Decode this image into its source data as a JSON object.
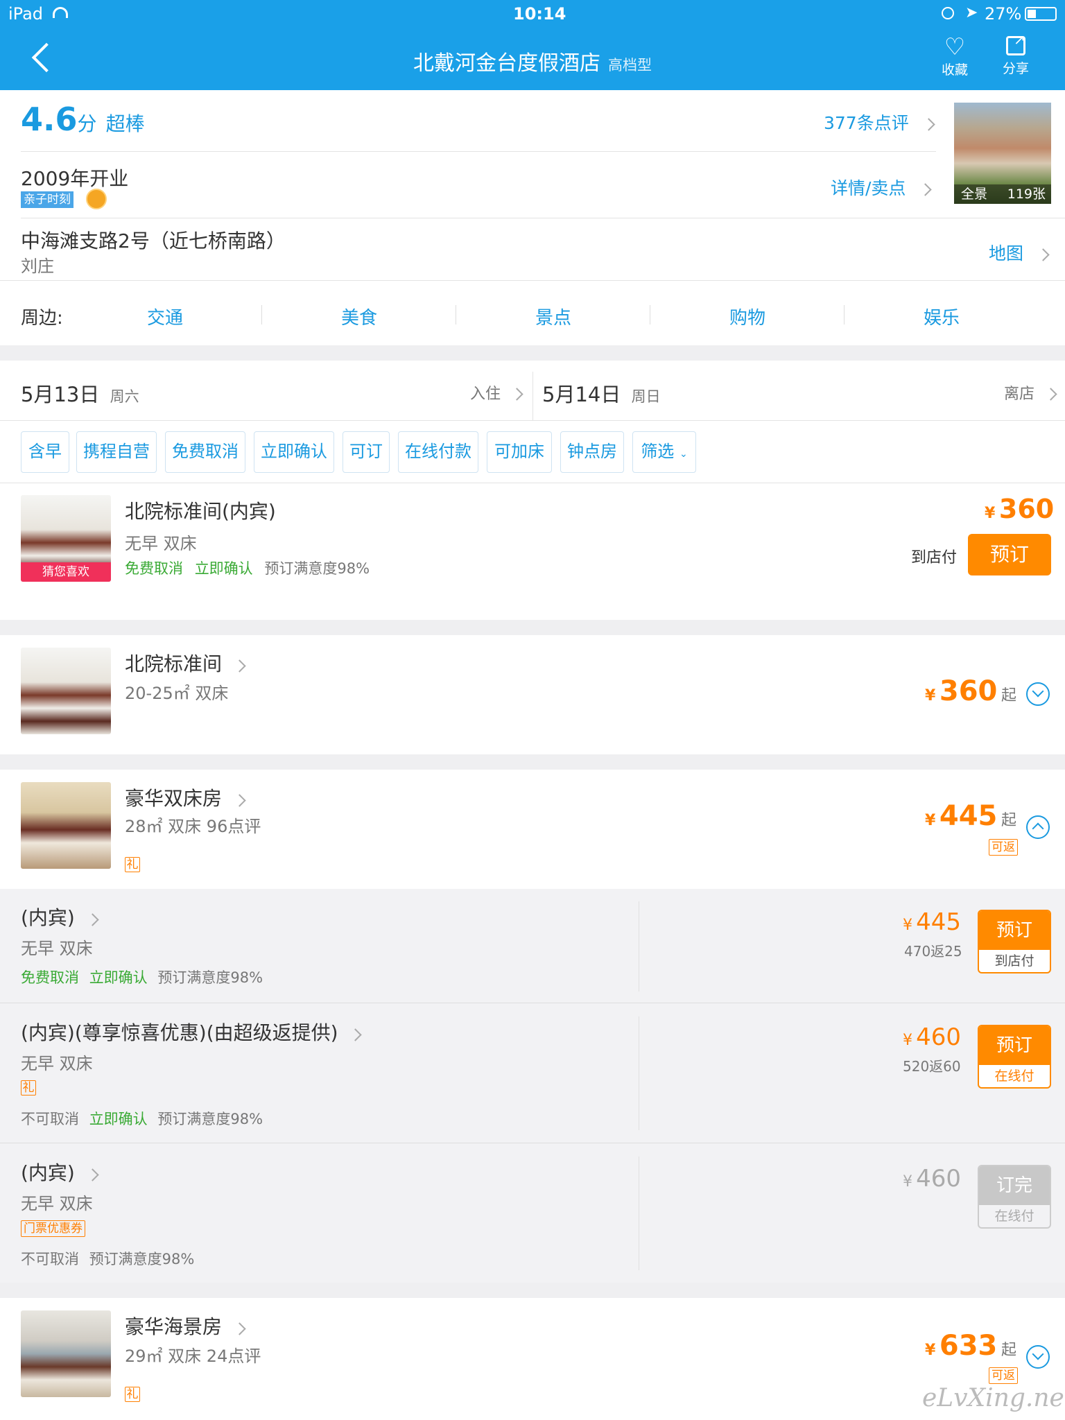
{
  "status": {
    "device": "iPad",
    "time": "10:14",
    "battery": "27%"
  },
  "nav": {
    "title": "北戴河金台度假酒店",
    "grade": "高档型",
    "fav": "收藏",
    "share": "分享"
  },
  "hotel": {
    "score": "4.6",
    "score_unit": "分",
    "score_text": "超棒",
    "reviews": "377条点评",
    "opened": "2009年开业",
    "tag": "亲子时刻",
    "details": "详情/卖点",
    "address": "中海滩支路2号（近七桥南路）",
    "area": "刘庄",
    "map": "地图",
    "photo_label": "全景",
    "photo_count": "119张"
  },
  "nearby": {
    "label": "周边:",
    "items": [
      "交通",
      "美食",
      "景点",
      "购物",
      "娱乐"
    ]
  },
  "dates": {
    "checkin": "5月13日",
    "checkin_day": "周六",
    "checkin_label": "入住",
    "checkout": "5月14日",
    "checkout_day": "周日",
    "checkout_label": "离店"
  },
  "filters": [
    "含早",
    "携程自营",
    "免费取消",
    "立即确认",
    "可订",
    "在线付款",
    "可加床",
    "钟点房",
    "筛选"
  ],
  "featured": {
    "name": "北院标准间(内宾)",
    "desc": "无早  双床",
    "tag1": "免费取消",
    "tag2": "立即确认",
    "satisfaction": "预订满意度98%",
    "badge": "猜您喜欢",
    "currency": "¥",
    "price": "360",
    "pay": "到店付",
    "book": "预订"
  },
  "rooms": [
    {
      "name": "北院标准间",
      "desc": "20-25㎡ 双床",
      "currency": "¥",
      "price": "360",
      "suffix": "起"
    },
    {
      "name": "豪华双床房",
      "desc": "28㎡ 双床 96点评",
      "currency": "¥",
      "price": "445",
      "suffix": "起",
      "rebate": "可返",
      "gift": "礼"
    },
    {
      "name": "豪华海景房",
      "desc": "29㎡ 双床 24点评",
      "currency": "¥",
      "price": "633",
      "suffix": "起",
      "rebate": "可返",
      "gift": "礼"
    }
  ],
  "suboffers": [
    {
      "name": "(内宾)",
      "desc": "无早   双床",
      "tag1": "免费取消",
      "tag2": "立即确认",
      "satisfaction": "预订满意度98%",
      "currency": "¥",
      "price": "445",
      "rebate": "470返25",
      "book": "预订",
      "pay": "到店付"
    },
    {
      "name": "(内宾)(尊享惊喜优惠)(由超级返提供)",
      "desc": "无早   双床",
      "gift": "礼",
      "tag1": "不可取消",
      "tag2": "立即确认",
      "satisfaction": "预订满意度98%",
      "currency": "¥",
      "price": "460",
      "rebate": "520返60",
      "book": "预订",
      "pay": "在线付"
    },
    {
      "name": "(内宾)",
      "desc": "无早   双床",
      "coupon": "门票优惠券",
      "tag1": "不可取消",
      "satisfaction": "预订满意度98%",
      "currency": "¥",
      "price": "460",
      "book": "订完",
      "pay": "在线付"
    }
  ],
  "watermark": "eLvXing.net",
  "colors": {
    "brand": "#1aa0e8",
    "accent": "#ff8a00",
    "green": "#3aaa35"
  }
}
